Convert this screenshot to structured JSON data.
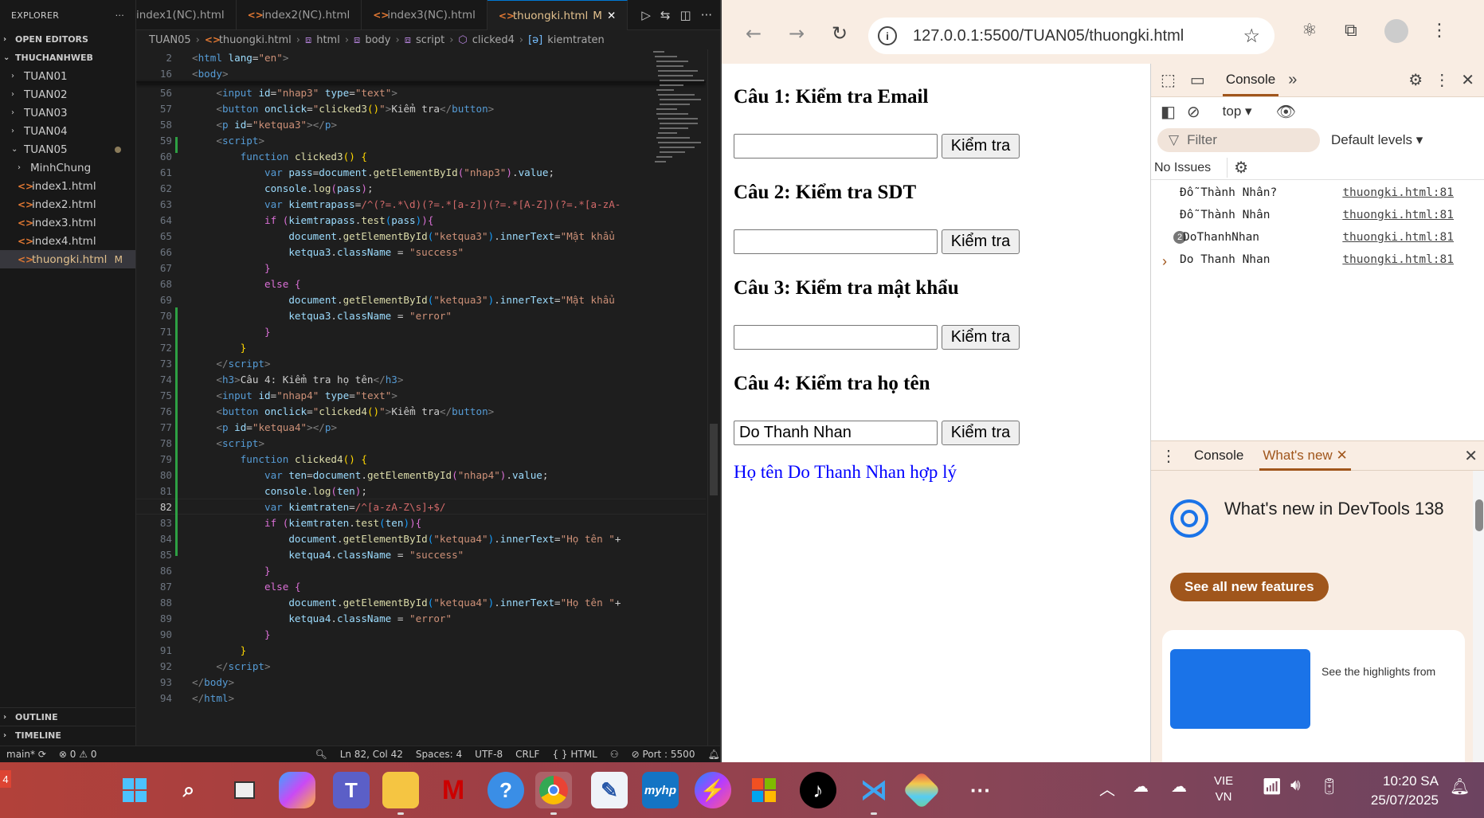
{
  "explorer": {
    "title": "EXPLORER",
    "open_editors": "OPEN EDITORS",
    "workspace": "THUCHANHWEB",
    "folders": [
      "TUAN01",
      "TUAN02",
      "TUAN03",
      "TUAN04",
      "TUAN05"
    ],
    "tuan05_items": [
      {
        "label": "MinhChung",
        "type": "folder"
      },
      {
        "label": "index1.html",
        "type": "html"
      },
      {
        "label": "index2.html",
        "type": "html"
      },
      {
        "label": "index3.html",
        "type": "html"
      },
      {
        "label": "index4.html",
        "type": "html"
      },
      {
        "label": "thuongki.html",
        "type": "html",
        "status": "M"
      }
    ],
    "outline": "OUTLINE",
    "timeline": "TIMELINE"
  },
  "tabs": [
    {
      "label": "index1(NC).html"
    },
    {
      "label": "index2(NC).html"
    },
    {
      "label": "index3(NC).html"
    },
    {
      "label": "thuongki.html",
      "status": "M",
      "active": true
    }
  ],
  "breadcrumb": [
    "TUAN05",
    "thuongki.html",
    "html",
    "body",
    "script",
    "clicked4",
    "kiemtraten"
  ],
  "editor": {
    "current_line": 82,
    "lines": [
      {
        "n": "2",
        "html": "<span class=\"x\">&lt;</span><span class=\"t\">html</span> <span class=\"a\">lang</span>=<span class=\"s\">\"en\"</span><span class=\"x\">&gt;</span>"
      },
      {
        "n": "16",
        "html": "<span class=\"x\">&lt;</span><span class=\"t\">body</span><span class=\"x\">&gt;</span>"
      },
      {
        "n": "56",
        "html": "    <span class=\"x\">&lt;</span><span class=\"t\">input</span> <span class=\"a\">id</span>=<span class=\"s\">\"nhap3\"</span> <span class=\"a\">type</span>=<span class=\"s\">\"text\"</span><span class=\"x\">&gt;</span>"
      },
      {
        "n": "57",
        "html": "    <span class=\"x\">&lt;</span><span class=\"t\">button</span> <span class=\"a\">onclick</span>=<span class=\"s\">\"</span><span class=\"f\">clicked3</span><span class=\"y\">()</span><span class=\"s\">\"</span><span class=\"x\">&gt;</span>Kiểm tra<span class=\"x\">&lt;/</span><span class=\"t\">button</span><span class=\"x\">&gt;</span>"
      },
      {
        "n": "58",
        "html": "    <span class=\"x\">&lt;</span><span class=\"t\">p</span> <span class=\"a\">id</span>=<span class=\"s\">\"ketqua3\"</span><span class=\"x\">&gt;&lt;/</span><span class=\"t\">p</span><span class=\"x\">&gt;</span>"
      },
      {
        "n": "59",
        "html": "    <span class=\"x\">&lt;</span><span class=\"t\">script</span><span class=\"x\">&gt;</span>"
      },
      {
        "n": "60",
        "html": "        <span class=\"k\">function</span> <span class=\"f\">clicked3</span><span class=\"y\">()</span> <span class=\"y\">{</span>"
      },
      {
        "n": "61",
        "html": "            <span class=\"k\">var</span> <span class=\"a\">pass</span>=<span class=\"a\">document</span>.<span class=\"f\">getElementById</span><span class=\"p\">(</span><span class=\"s\">\"nhap3\"</span><span class=\"p\">)</span>.<span class=\"a\">value</span>;"
      },
      {
        "n": "62",
        "html": "            <span class=\"a\">console</span>.<span class=\"f\">log</span><span class=\"p\">(</span><span class=\"a\">pass</span><span class=\"p\">)</span>;"
      },
      {
        "n": "63",
        "html": "            <span class=\"k\">var</span> <span class=\"a\">kiemtrapass</span>=<span class=\"r\">/^(?=.*\\d)(?=.*[a-z])(?=.*[A-Z])(?=.*[a-zA-</span>"
      },
      {
        "n": "64",
        "html": "            <span class=\"p\">if</span> <span class=\"p\">(</span><span class=\"a\">kiemtrapass</span>.<span class=\"f\">test</span><span class=\"b\">(</span><span class=\"a\">pass</span><span class=\"b\">)</span><span class=\"p\">){</span>"
      },
      {
        "n": "65",
        "html": "                <span class=\"a\">document</span>.<span class=\"f\">getElementById</span><span class=\"b\">(</span><span class=\"s\">\"ketqua3\"</span><span class=\"b\">)</span>.<span class=\"a\">innerText</span>=<span class=\"s\">\"Mật khẩu</span>"
      },
      {
        "n": "66",
        "html": "                <span class=\"a\">ketqua3</span>.<span class=\"a\">className</span> = <span class=\"s\">\"success\"</span>"
      },
      {
        "n": "67",
        "html": "            <span class=\"p\">}</span>"
      },
      {
        "n": "68",
        "html": "            <span class=\"p\">else</span> <span class=\"p\">{</span>"
      },
      {
        "n": "69",
        "html": "                <span class=\"a\">document</span>.<span class=\"f\">getElementById</span><span class=\"b\">(</span><span class=\"s\">\"ketqua3\"</span><span class=\"b\">)</span>.<span class=\"a\">innerText</span>=<span class=\"s\">\"Mật khẩu</span>"
      },
      {
        "n": "70",
        "html": "                <span class=\"a\">ketqua3</span>.<span class=\"a\">className</span> = <span class=\"s\">\"error\"</span>"
      },
      {
        "n": "71",
        "html": "            <span class=\"p\">}</span>"
      },
      {
        "n": "72",
        "html": "        <span class=\"y\">}</span>"
      },
      {
        "n": "73",
        "html": "    <span class=\"x\">&lt;/</span><span class=\"t\">script</span><span class=\"x\">&gt;</span>"
      },
      {
        "n": "74",
        "html": "    <span class=\"x\">&lt;</span><span class=\"t\">h3</span><span class=\"x\">&gt;</span>Câu 4: Kiểm tra họ tên<span class=\"x\">&lt;/</span><span class=\"t\">h3</span><span class=\"x\">&gt;</span>"
      },
      {
        "n": "75",
        "html": "    <span class=\"x\">&lt;</span><span class=\"t\">input</span> <span class=\"a\">id</span>=<span class=\"s\">\"nhap4\"</span> <span class=\"a\">type</span>=<span class=\"s\">\"text\"</span><span class=\"x\">&gt;</span>"
      },
      {
        "n": "76",
        "html": "    <span class=\"x\">&lt;</span><span class=\"t\">button</span> <span class=\"a\">onclick</span>=<span class=\"s\">\"</span><span class=\"f\">clicked4</span><span class=\"y\">()</span><span class=\"s\">\"</span><span class=\"x\">&gt;</span>Kiểm tra<span class=\"x\">&lt;/</span><span class=\"t\">button</span><span class=\"x\">&gt;</span>"
      },
      {
        "n": "77",
        "html": "    <span class=\"x\">&lt;</span><span class=\"t\">p</span> <span class=\"a\">id</span>=<span class=\"s\">\"ketqua4\"</span><span class=\"x\">&gt;&lt;/</span><span class=\"t\">p</span><span class=\"x\">&gt;</span>"
      },
      {
        "n": "78",
        "html": "    <span class=\"x\">&lt;</span><span class=\"t\">script</span><span class=\"x\">&gt;</span>"
      },
      {
        "n": "79",
        "html": "        <span class=\"k\">function</span> <span class=\"f\">clicked4</span><span class=\"y\">()</span> <span class=\"y\">{</span>"
      },
      {
        "n": "80",
        "html": "            <span class=\"k\">var</span> <span class=\"a\">ten</span>=<span class=\"a\">document</span>.<span class=\"f\">getElementById</span><span class=\"p\">(</span><span class=\"s\">\"nhap4\"</span><span class=\"p\">)</span>.<span class=\"a\">value</span>;"
      },
      {
        "n": "81",
        "html": "            <span class=\"a\">console</span>.<span class=\"f\">log</span><span class=\"p\">(</span><span class=\"a\">ten</span><span class=\"p\">)</span>;"
      },
      {
        "n": "82",
        "html": "            <span class=\"k\">var</span> <span class=\"a\">kiemtraten</span>=<span class=\"r\">/^[a-zA-Z\\s]+$/</span>"
      },
      {
        "n": "83",
        "html": "            <span class=\"p\">if</span> <span class=\"p\">(</span><span class=\"a\">kiemtraten</span>.<span class=\"f\">test</span><span class=\"b\">(</span><span class=\"a\">ten</span><span class=\"b\">)</span><span class=\"p\">){</span>"
      },
      {
        "n": "84",
        "html": "                <span class=\"a\">document</span>.<span class=\"f\">getElementById</span><span class=\"b\">(</span><span class=\"s\">\"ketqua4\"</span><span class=\"b\">)</span>.<span class=\"a\">innerText</span>=<span class=\"s\">\"Họ tên \"</span>+"
      },
      {
        "n": "85",
        "html": "                <span class=\"a\">ketqua4</span>.<span class=\"a\">className</span> = <span class=\"s\">\"success\"</span>"
      },
      {
        "n": "86",
        "html": "            <span class=\"p\">}</span>"
      },
      {
        "n": "87",
        "html": "            <span class=\"p\">else</span> <span class=\"p\">{</span>"
      },
      {
        "n": "88",
        "html": "                <span class=\"a\">document</span>.<span class=\"f\">getElementById</span><span class=\"b\">(</span><span class=\"s\">\"ketqua4\"</span><span class=\"b\">)</span>.<span class=\"a\">innerText</span>=<span class=\"s\">\"Họ tên \"</span>+"
      },
      {
        "n": "89",
        "html": "                <span class=\"a\">ketqua4</span>.<span class=\"a\">className</span> = <span class=\"s\">\"error\"</span>"
      },
      {
        "n": "90",
        "html": "            <span class=\"p\">}</span>"
      },
      {
        "n": "91",
        "html": "        <span class=\"y\">}</span>"
      },
      {
        "n": "92",
        "html": "    <span class=\"x\">&lt;/</span><span class=\"t\">script</span><span class=\"x\">&gt;</span>"
      },
      {
        "n": "93",
        "html": "<span class=\"x\">&lt;/</span><span class=\"t\">body</span><span class=\"x\">&gt;</span>"
      },
      {
        "n": "94",
        "html": "<span class=\"x\">&lt;/</span><span class=\"t\">html</span><span class=\"x\">&gt;</span>"
      }
    ]
  },
  "statusbar": {
    "branch": "main*",
    "problems": "0",
    "warnings": "0",
    "position": "Ln 82, Col 42",
    "spaces": "Spaces: 4",
    "encoding": "UTF-8",
    "eol": "CRLF",
    "language": "HTML",
    "port": "Port : 5500"
  },
  "chrome": {
    "url": "127.0.0.1:5500/TUAN05/thuongki.html",
    "page": {
      "q1": "Câu 1: Kiểm tra Email",
      "q2": "Câu 2: Kiểm tra SDT",
      "q3": "Câu 3: Kiểm tra mật khẩu",
      "q4": "Câu 4: Kiểm tra họ tên",
      "button_label": "Kiểm tra",
      "q1_value": "",
      "q2_value": "",
      "q3_value": "",
      "q4_value": "Do Thanh Nhan",
      "result4": "Họ tên Do Thanh Nhan hợp lý",
      "result_color": "#0000ff"
    },
    "devtools": {
      "tab_console": "Console",
      "context": "top",
      "filter_placeholder": "Filter",
      "levels": "Default levels",
      "no_issues": "No Issues",
      "logs": [
        {
          "msg": "Đỗ Thành Nhân?",
          "src": "thuongki.html:81"
        },
        {
          "msg": "Đỗ Thành Nhân",
          "src": "thuongki.html:81"
        },
        {
          "msg": "DoThanhNhan",
          "src": "thuongki.html:81",
          "count": "2"
        },
        {
          "msg": "Do Thanh Nhan",
          "src": "thuongki.html:81"
        }
      ],
      "drawer_tabs": [
        "Console",
        "What's new"
      ],
      "whats_new_title": "What's new in DevTools 138",
      "see_all": "See all new features",
      "highlight_snippet": "See the highlights from",
      "accent": "#a0561c"
    }
  },
  "taskbar": {
    "notification_count": "4",
    "lang_line1": "VIE",
    "lang_line2": "VN",
    "time": "10:20 SA",
    "date": "25/07/2025"
  }
}
